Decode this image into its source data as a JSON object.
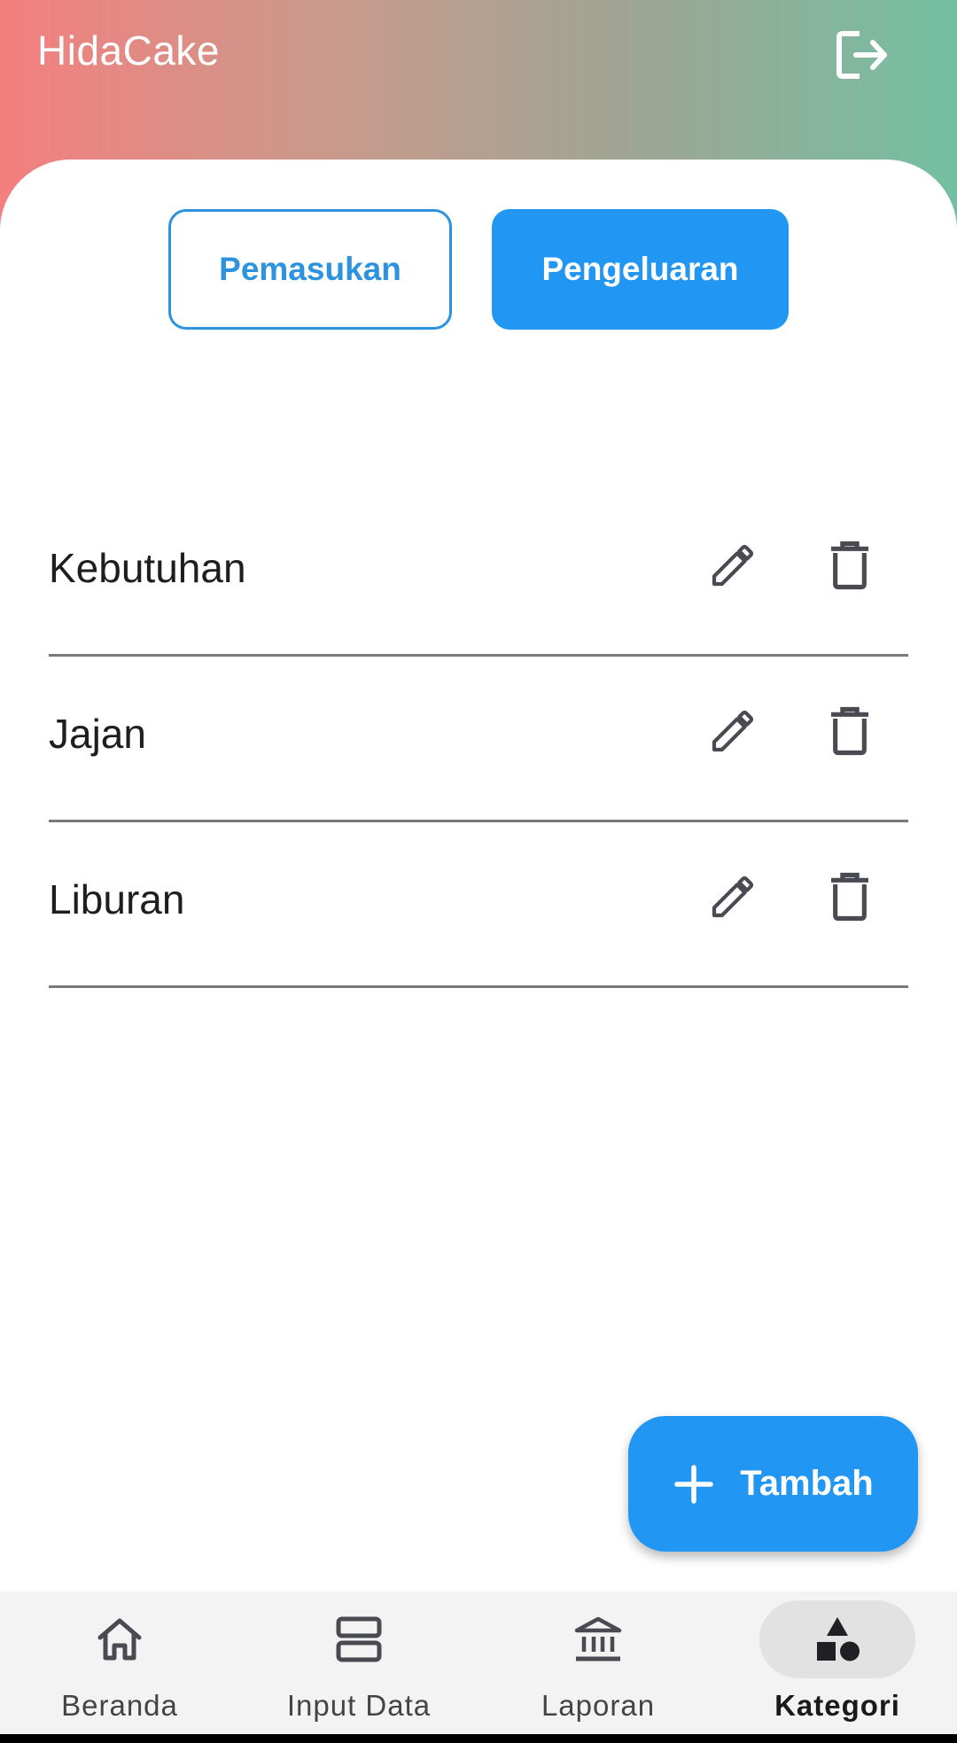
{
  "header": {
    "title": "HidaCake",
    "logout_icon": "logout-icon"
  },
  "toggle": {
    "income_label": "Pemasukan",
    "expense_label": "Pengeluaran",
    "selected": "Pengeluaran"
  },
  "categories": [
    {
      "name": "Kebutuhan"
    },
    {
      "name": "Jajan"
    },
    {
      "name": "Liburan"
    }
  ],
  "fab": {
    "label": "Tambah",
    "icon": "plus-icon"
  },
  "bottom_nav": {
    "items": [
      {
        "label": "Beranda",
        "icon": "home-icon",
        "active": false
      },
      {
        "label": "Input Data",
        "icon": "input-data-icon",
        "active": false
      },
      {
        "label": "Laporan",
        "icon": "bank-icon",
        "active": false
      },
      {
        "label": "Kategori",
        "icon": "category-shapes-icon",
        "active": true
      }
    ]
  },
  "colors": {
    "header_gradient_start": "#f47f7f",
    "header_gradient_end": "#74bfa2",
    "primary": "#2196f3",
    "outline_primary": "#2d93de"
  }
}
